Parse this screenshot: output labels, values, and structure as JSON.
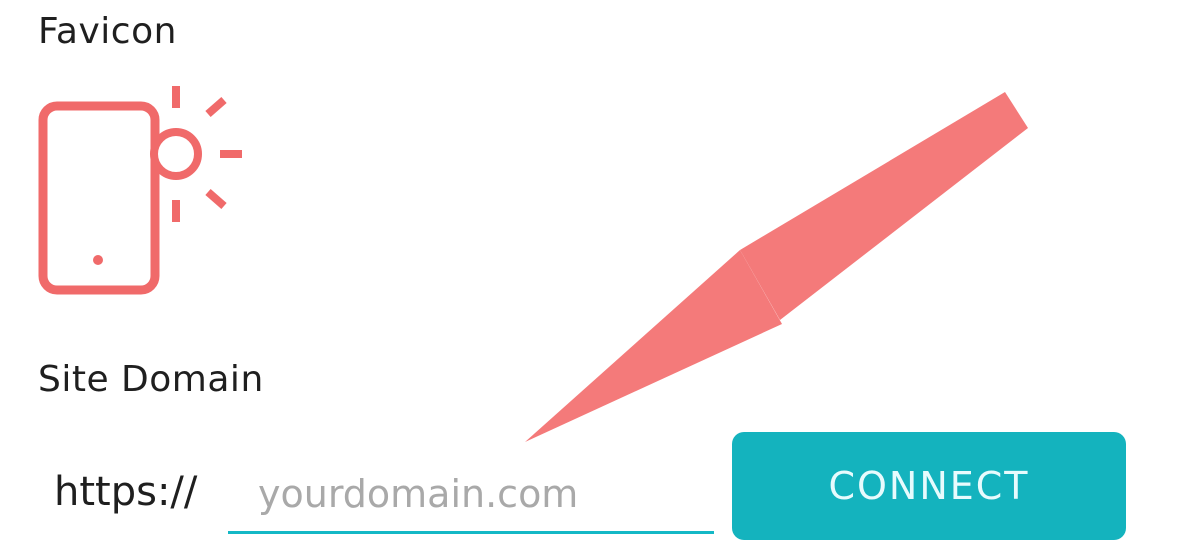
{
  "favicon": {
    "label": "Favicon",
    "icon": "phone-sun-icon"
  },
  "site_domain": {
    "label": "Site Domain",
    "prefix": "https://",
    "input_value": "",
    "input_placeholder": "yourdomain.com",
    "connect_label": "CONNECT"
  },
  "colors": {
    "accent": "#14b3be",
    "favicon_coral": "#f06a6a",
    "annotation_arrow": "#f47a7a"
  }
}
